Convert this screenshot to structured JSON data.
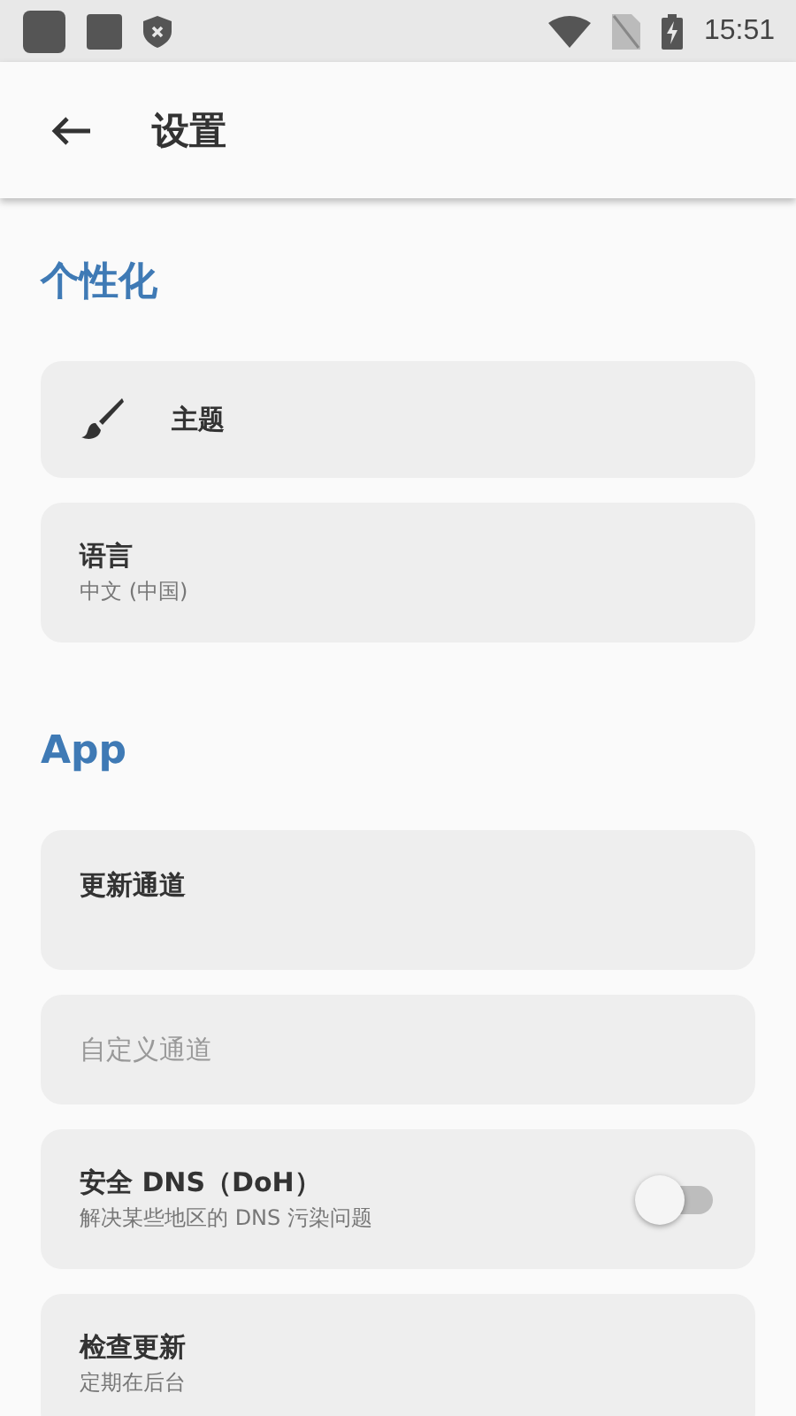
{
  "status_bar": {
    "time": "15:51"
  },
  "app_bar": {
    "title": "设置"
  },
  "sections": [
    {
      "title": "个性化",
      "items": [
        {
          "kind": "icon",
          "title": "主题"
        },
        {
          "kind": "text",
          "title": "语言",
          "subtitle": "中文 (中国)"
        }
      ]
    },
    {
      "title": "App",
      "items": [
        {
          "kind": "tall",
          "title": "更新通道"
        },
        {
          "kind": "text",
          "title": "自定义通道",
          "disabled": true
        },
        {
          "kind": "switch",
          "title": "安全 DNS（DoH）",
          "subtitle": "解决某些地区的 DNS 污染问题",
          "on": false
        },
        {
          "kind": "text",
          "title": "检查更新",
          "subtitle": "定期在后台"
        }
      ]
    }
  ]
}
